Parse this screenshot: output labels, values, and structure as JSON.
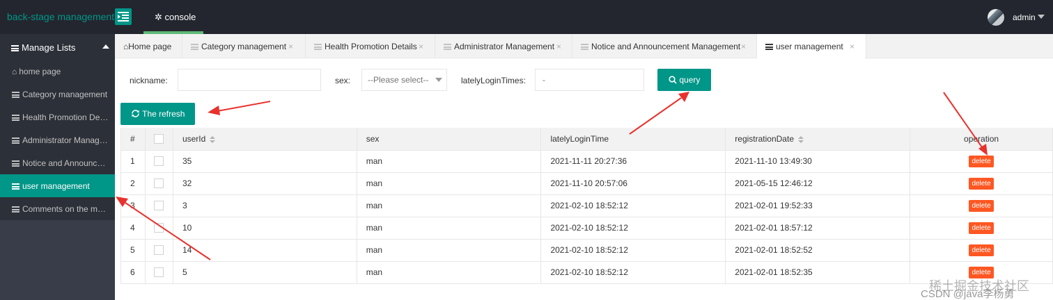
{
  "header": {
    "logo": "back-stage management",
    "console_tab": "console",
    "user_name": "admin"
  },
  "sidebar": {
    "section_title": "Manage Lists",
    "items": [
      {
        "label": "home page",
        "icon": "home-icon"
      },
      {
        "label": "Category management",
        "icon": "list-icon"
      },
      {
        "label": "Health Promotion Details",
        "icon": "list-icon"
      },
      {
        "label": "Administrator Management",
        "icon": "list-icon"
      },
      {
        "label": "Notice and Announcement Management",
        "icon": "list-icon"
      },
      {
        "label": "user management",
        "icon": "list-icon",
        "active": true
      },
      {
        "label": "Comments on the management",
        "icon": "list-icon"
      }
    ]
  },
  "tabs": [
    {
      "label": "Home page",
      "icon": "home-icon"
    },
    {
      "label": "Category management",
      "icon": "list-icon",
      "close": "×"
    },
    {
      "label": "Health Promotion Details",
      "icon": "list-icon",
      "close": "×"
    },
    {
      "label": "Administrator Management",
      "icon": "list-icon",
      "close": "×"
    },
    {
      "label": "Notice and Announcement Management",
      "icon": "list-icon",
      "close": "×"
    },
    {
      "label": "user management",
      "icon": "list-icon",
      "close": "×",
      "active": true
    }
  ],
  "search": {
    "nickname_label": "nickname:",
    "nickname_value": "",
    "sex_label": "sex:",
    "sex_selected": "--Please select--",
    "login_label": "latelyLoginTimes:",
    "login_value": "-",
    "query_button": "query",
    "refresh_button": "The refresh"
  },
  "table": {
    "headers": {
      "index": "#",
      "userId": "userId",
      "sex": "sex",
      "lastLogin": "latelyLoginTime",
      "registration": "registrationDate",
      "operation": "operation"
    },
    "delete_label": "delete",
    "rows": [
      {
        "index": "1",
        "userId": "35",
        "sex": "man",
        "lastLogin": "2021-11-11 20:27:36",
        "registration": "2021-11-10 13:49:30"
      },
      {
        "index": "2",
        "userId": "32",
        "sex": "man",
        "lastLogin": "2021-11-10 20:57:06",
        "registration": "2021-05-15 12:46:12"
      },
      {
        "index": "3",
        "userId": "3",
        "sex": "man",
        "lastLogin": "2021-02-10 18:52:12",
        "registration": "2021-02-01 19:52:33"
      },
      {
        "index": "4",
        "userId": "10",
        "sex": "man",
        "lastLogin": "2021-02-10 18:52:12",
        "registration": "2021-02-01 18:57:12"
      },
      {
        "index": "5",
        "userId": "14",
        "sex": "man",
        "lastLogin": "2021-02-10 18:52:12",
        "registration": "2021-02-01 18:52:52"
      },
      {
        "index": "6",
        "userId": "5",
        "sex": "man",
        "lastLogin": "2021-02-10 18:52:12",
        "registration": "2021-02-01 18:52:35"
      }
    ]
  },
  "watermark": {
    "line1": "稀土掘金技术社区",
    "line2": "CSDN @java李杨勇"
  },
  "colors": {
    "accent": "#009688",
    "header_bg": "#23262e",
    "sidebar_bg": "#393d49",
    "danger": "#ff5722",
    "annotation": "#e8322d"
  }
}
